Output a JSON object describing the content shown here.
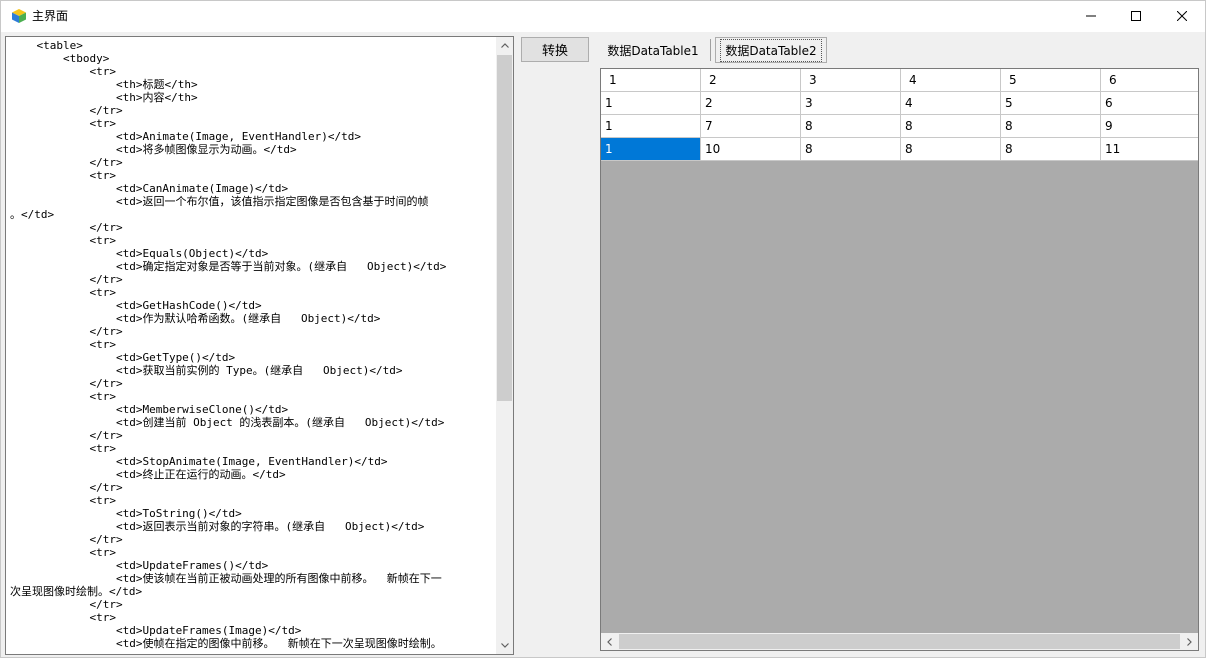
{
  "window": {
    "title": "主界面",
    "controls": {
      "minimize": "minimize-icon",
      "maximize": "maximize-icon",
      "close": "close-icon"
    }
  },
  "editor": {
    "lines": [
      "    <table>",
      "        <tbody>",
      "            <tr>",
      "                <th>标题</th>",
      "                <th>内容</th>",
      "            </tr>",
      "            <tr>",
      "                <td>Animate(Image, EventHandler)</td>",
      "                <td>将多帧图像显示为动画。</td>",
      "            </tr>",
      "            <tr>",
      "                <td>CanAnimate(Image)</td>",
      "                <td>返回一个布尔值，该值指示指定图像是否包含基于时间的帧",
      "。</td>",
      "            </tr>",
      "            <tr>",
      "                <td>Equals(Object)</td>",
      "                <td>确定指定对象是否等于当前对象。(继承自   Object)</td>",
      "            </tr>",
      "            <tr>",
      "                <td>GetHashCode()</td>",
      "                <td>作为默认哈希函数。(继承自   Object)</td>",
      "            </tr>",
      "            <tr>",
      "                <td>GetType()</td>",
      "                <td>获取当前实例的 Type。(继承自   Object)</td>",
      "            </tr>",
      "            <tr>",
      "                <td>MemberwiseClone()</td>",
      "                <td>创建当前 Object 的浅表副本。(继承自   Object)</td>",
      "            </tr>",
      "            <tr>",
      "                <td>StopAnimate(Image, EventHandler)</td>",
      "                <td>终止正在运行的动画。</td>",
      "            </tr>",
      "            <tr>",
      "                <td>ToString()</td>",
      "                <td>返回表示当前对象的字符串。(继承自   Object)</td>",
      "            </tr>",
      "            <tr>",
      "                <td>UpdateFrames()</td>",
      "                <td>使该帧在当前正被动画处理的所有图像中前移。  新帧在下一",
      "次呈现图像时绘制。</td>",
      "            </tr>",
      "            <tr>",
      "                <td>UpdateFrames(Image)</td>",
      "                <td>使帧在指定的图像中前移。  新帧在下一次呈现图像时绘制。"
    ]
  },
  "toolbar": {
    "convert_label": "转换"
  },
  "tabs": [
    {
      "label": "数据DataTable1",
      "active": false
    },
    {
      "label": "数据DataTable2",
      "active": true
    }
  ],
  "grid": {
    "header": [
      "1",
      "2",
      "3",
      "4",
      "5",
      "6"
    ],
    "rows": [
      [
        "1",
        "2",
        "3",
        "4",
        "5",
        "6"
      ],
      [
        "1",
        "7",
        "8",
        "8",
        "8",
        "9"
      ],
      [
        "1",
        "10",
        "8",
        "8",
        "8",
        "11"
      ]
    ],
    "selected_cell": {
      "row": 2,
      "col": 0
    },
    "colors": {
      "selection": "#0078d7",
      "empty_area": "#ababab"
    }
  }
}
